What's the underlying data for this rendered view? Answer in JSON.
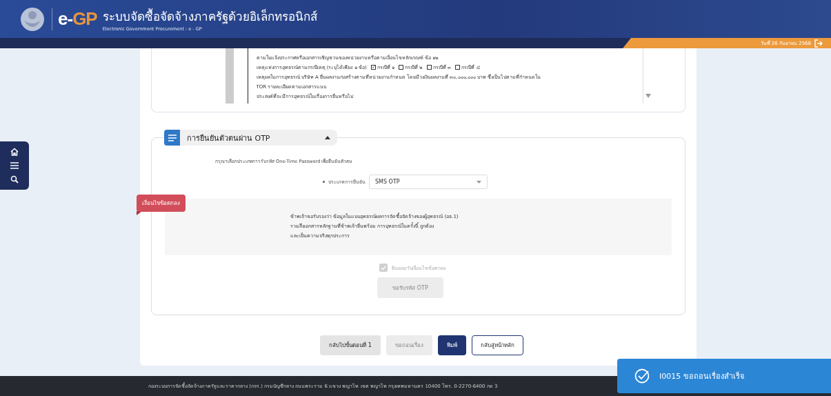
{
  "header": {
    "logo_prefix": "e-",
    "logo_suffix": "GP",
    "title": "ระบบจัดซื้อจัดจ้างภาครัฐด้วยอิเล็กทรอนิกส์",
    "subtitle": "Electronic Government Procurement : e - GP",
    "date": "วันที่ 26 กันยายน 2568"
  },
  "sidebar": [
    {
      "kind": "home"
    },
    {
      "kind": "menu"
    },
    {
      "kind": "search"
    }
  ],
  "document": {
    "lines": [
      {
        "kind": "text",
        "text": "ตามใบแจ้งประกาศหรือเอกสารเชิญชวนของหน่วยงานหรือตามเงื่อนไขหลักเกณฑ์ ข้อ ๑๒"
      },
      {
        "kind": "checks",
        "text": "เหตุแห่งการอุทธรณ์ตามกรณีเหตุ (ระบุได้เพียง ๑ ข้อ)",
        "options": [
          {
            "label": "กรณีที่ ๑",
            "checked": true
          },
          {
            "label": "กรณีที่ ๒",
            "checked": false
          },
          {
            "label": "กรณีที่ ๓",
            "checked": false
          },
          {
            "label": "กรณีที่ ๔",
            "checked": false
          }
        ]
      },
      {
        "kind": "text",
        "text": "เหตุผลในการอุทธรณ์ บริษัท A ยื่นผลงานก่อสร้างตามที่หน่วยงานกำหนด โดยมีวงเงินผลงานที่ ๓๐,๐๐๐,๐๐๐ บาท ซึ่งเป็นไปตามที่กำหนดใน"
      },
      {
        "kind": "text",
        "text": "TOR รายละเอียดตามเอกสารแนบ"
      },
      {
        "kind": "text",
        "text": "ประสงค์ที่จะมีการอุทธรณ์ในเรื่องการยื่นหรือไม่"
      }
    ]
  },
  "otp_section": {
    "title": "การยืนยันตัวตนผ่าน OTP",
    "expanded": true,
    "instruction": "กรุณาเลือกประเภทการรับรหัส One-Time Password เพื่อยืนยันตัวตน",
    "type_label": "ประเภทการยืนยัน",
    "required": true,
    "type_value": "SMS OTP"
  },
  "agreement": {
    "ribbon": "เงื่อนไขข้อตกลง",
    "lines": [
      "ข้าพเจ้าขอรับรองว่า ข้อมูลในแบบอุทธรณ์ผลการจัดซื้อจัดจ้างของผู้อุทธรณ์ (อธ.1)",
      "รวมถึงเอกสารหลักฐานที่ข้าพเจ้ายื่นพร้อม การอุทธรณ์ในครั้งนี้ ถูกต้อง",
      "และเป็นความจริงทุกประการ"
    ],
    "accept_label": "ยินยอมรับเงื่อนไขข้อตกลง",
    "accepted": true,
    "accept_disabled": true
  },
  "otp_button": {
    "label": "ขอรับรหัส OTP",
    "disabled": true
  },
  "actions": [
    {
      "label": "กลับไปขั้นตอนที่ 1",
      "kind": "secondary",
      "disabled": false
    },
    {
      "label": "ขอถอนเรื่อง",
      "kind": "secondary",
      "disabled": true
    },
    {
      "label": "พิมพ์",
      "kind": "primary",
      "disabled": false
    },
    {
      "label": "กลับสู่หน้าหลัก",
      "kind": "outline",
      "disabled": false
    }
  ],
  "toast": {
    "text": "I0015 ขอถอนเรื่องสำเร็จ"
  },
  "footer": {
    "text": "กองระบบการจัดซื้อจัดจ้างภาครัฐและราคากลาง (กจร.) กรมบัญชีกลาง ถนนพระราม 6 แขวง พญาไท เขต พญาไท กรุงเทพมหานคร 10400 โทร. 0-2270-6400 กด 3"
  }
}
